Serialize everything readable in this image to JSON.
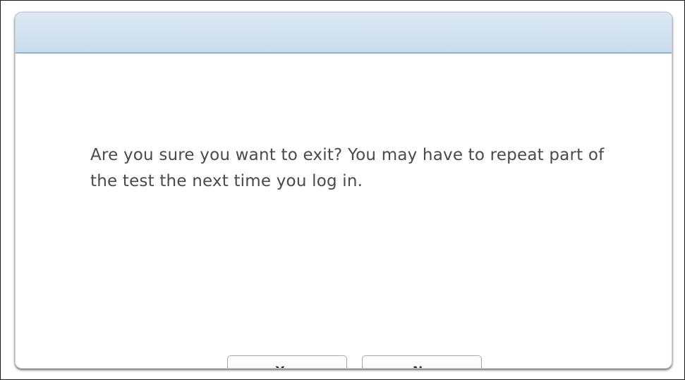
{
  "dialog": {
    "message": "Are you sure you want to exit?  You may have to repeat part of the test the next time you log in.",
    "buttons": {
      "yes_label": "Yes",
      "no_label": "No"
    }
  },
  "colors": {
    "header_top": "#dce8f3",
    "header_bottom": "#c9ddee",
    "header_border": "#8fb3d1",
    "message_text": "#4a4a4a",
    "button_text": "#333333"
  }
}
